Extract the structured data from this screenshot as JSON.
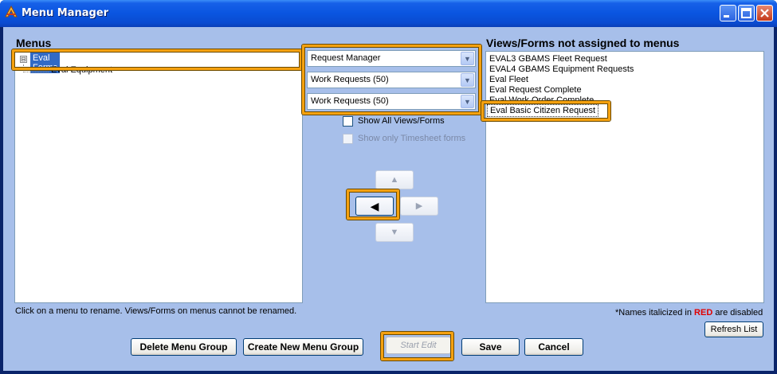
{
  "window": {
    "title": "Menu Manager",
    "icons": {
      "app": "app-logo-icon",
      "minimize": "minimize-icon",
      "maximize": "maximize-icon",
      "close": "close-icon"
    }
  },
  "menus": {
    "label": "Menus",
    "tree": {
      "root": "Eval Forms",
      "root_sign": "⊟",
      "children": [
        "Eval Equipment"
      ]
    },
    "hint": "Click on a menu to rename. Views/Forms on menus cannot be renamed."
  },
  "filters": {
    "combo1": "Request Manager",
    "combo2": "Work Requests (50)",
    "combo3": "Work Requests (50)",
    "show_all": "Show All Views/Forms",
    "show_timesheet": "Show only Timesheet forms"
  },
  "move_buttons": {
    "up": "▲",
    "left": "◀",
    "right": "▶",
    "down": "▼"
  },
  "unassigned": {
    "label": "Views/Forms not assigned to menus",
    "items": [
      "EVAL3 GBAMS Fleet Request",
      "EVAL4 GBAMS Equipment Requests",
      "Eval Fleet",
      "Eval Request Complete",
      "Eval Work Order Complete",
      "Eval Basic Citizen Request"
    ],
    "note_prefix": "*Names italicized in",
    "note_red": "RED",
    "note_suffix": "are disabled",
    "refresh": "Refresh List"
  },
  "buttons": {
    "delete_group": "Delete Menu Group",
    "create_group": "Create New Menu Group",
    "start_edit": "Start Edit",
    "save": "Save",
    "cancel": "Cancel"
  },
  "colors": {
    "highlight": "#f5a10f",
    "client_bg": "#a7bfea",
    "selection": "#316ac5",
    "disabled_red": "#e00000"
  }
}
